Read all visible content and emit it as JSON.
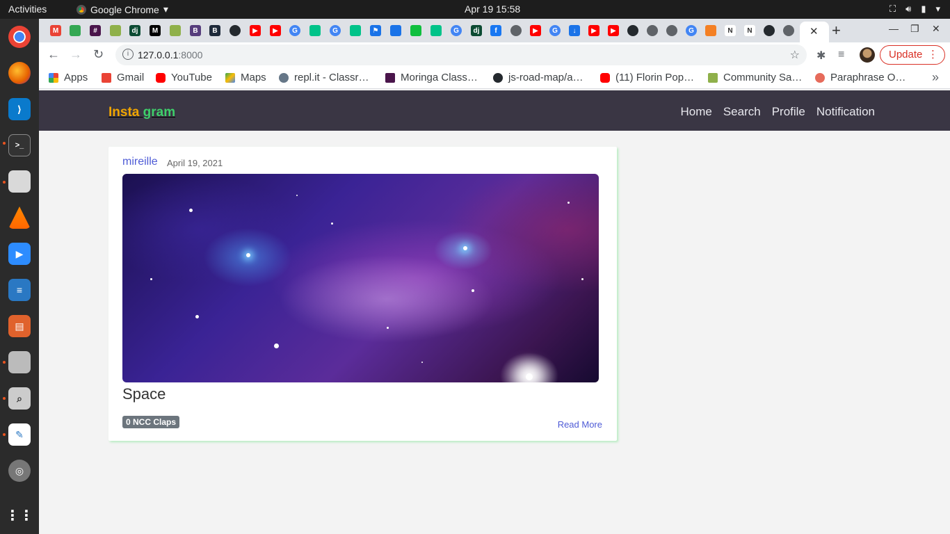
{
  "system": {
    "activities": "Activities",
    "app_name": "Google Chrome",
    "app_caret": "▾",
    "clock": "Apr 19  15:58"
  },
  "browser": {
    "url_host": "127.0.0.1",
    "url_port": ":8000",
    "update_label": "Update",
    "tab_close": "✕",
    "new_tab": "+",
    "bookmarks": [
      {
        "label": "Apps",
        "color": "#4285f4"
      },
      {
        "label": "Gmail",
        "color": "#ea4335"
      },
      {
        "label": "YouTube",
        "color": "#ff0000"
      },
      {
        "label": "Maps",
        "color": "#34a853"
      },
      {
        "label": "repl.it - Classr…",
        "color": "#667788"
      },
      {
        "label": "Moringa Class…",
        "color": "#4a154b"
      },
      {
        "label": "js-road-map/a…",
        "color": "#24292e"
      },
      {
        "label": "(11) Florin Pop…",
        "color": "#ff0000"
      },
      {
        "label": "Community Sa…",
        "color": "#8fb04a"
      },
      {
        "label": "Paraphrase O…",
        "color": "#e66b5b"
      }
    ]
  },
  "site": {
    "brand_part1": "Insta",
    "brand_part2": "gram",
    "nav": [
      "Home",
      "Search",
      "Profile",
      "Notification"
    ]
  },
  "post": {
    "user": "mireille",
    "date": "April 19, 2021",
    "title": "Space",
    "claps": "0 NCC Claps",
    "read_more": "Read More"
  },
  "colors": {
    "nav_bg": "#3a3644",
    "brand_orange": "#f0a500",
    "brand_green": "#3ecf6a",
    "link_blue": "#4e5bd6"
  }
}
